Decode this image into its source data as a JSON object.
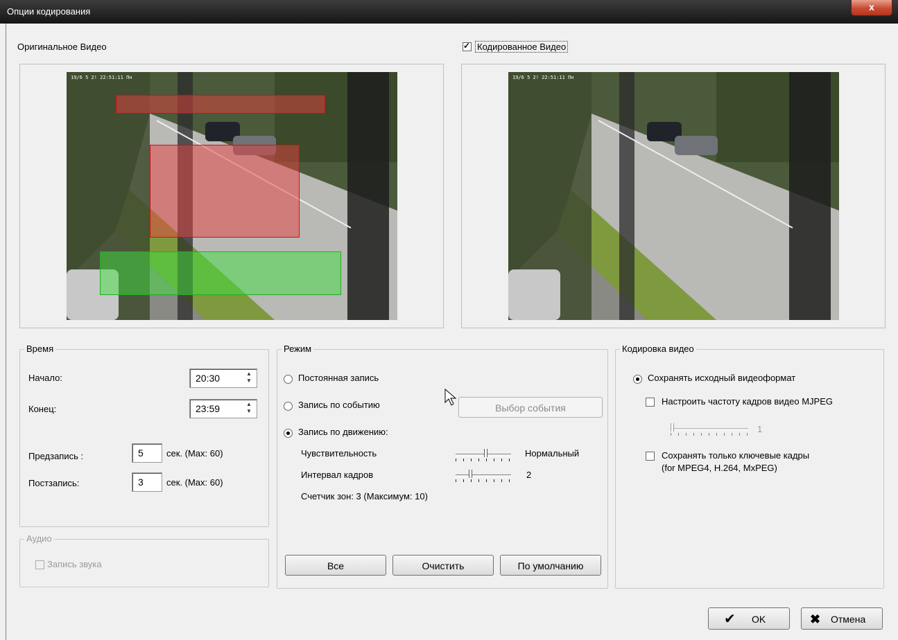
{
  "window": {
    "title": "Опции кодирования",
    "close_symbol": "x"
  },
  "original_video": {
    "label": "Оригинальное Видео",
    "timestamp": "19/6 5 2! 22:51:11 Пн"
  },
  "encoded_video": {
    "label": "Кодированное Видео",
    "checked": true,
    "timestamp": "19/6 5 2! 22:51:11 Пн"
  },
  "time": {
    "legend": "Время",
    "start_label": "Начало:",
    "start_value": "20:30",
    "end_label": "Конец:",
    "end_value": "23:59",
    "pre_label": "Предзапись :",
    "pre_value": "5",
    "pre_unit": "сек.  (Max: 60)",
    "post_label": "Постзапись:",
    "post_value": "3",
    "post_unit": "сек.  (Max: 60)"
  },
  "audio": {
    "legend": "Аудио",
    "record_label": "Запись звука"
  },
  "mode": {
    "legend": "Режим",
    "constant_label": "Постоянная запись",
    "event_label": "Запись по событию",
    "event_button": "Выбор события",
    "motion_label": "Запись по движению:",
    "selected": "motion",
    "sensitivity_label": "Чувствительность",
    "sensitivity_value": "Нормальный",
    "sensitivity_level": 0.55,
    "interval_label": "Интервал кадров",
    "interval_value": "2",
    "interval_level": 0.25,
    "zone_counter": "Счетчик зон: 3  (Максимум: 10)",
    "btn_all": "Все",
    "btn_clear": "Очистить",
    "btn_default": "По умолчанию"
  },
  "encoding": {
    "legend": "Кодировка видео",
    "keep_format_label": "Сохранять исходный видеоформат",
    "mjpeg_label": "Настроить частоту кадров видео MJPEG",
    "mjpeg_value": "1",
    "mjpeg_level": 0,
    "keyframes_label": "Сохранять только ключевые кадры",
    "keyframes_note": "(for MPEG4, H.264, MxPEG)"
  },
  "footer": {
    "ok_label": "OK",
    "cancel_label": "Отмена"
  },
  "colors": {
    "zone_red": "#e84040",
    "zone_green": "#40e040",
    "accent_close": "#c94a33"
  }
}
